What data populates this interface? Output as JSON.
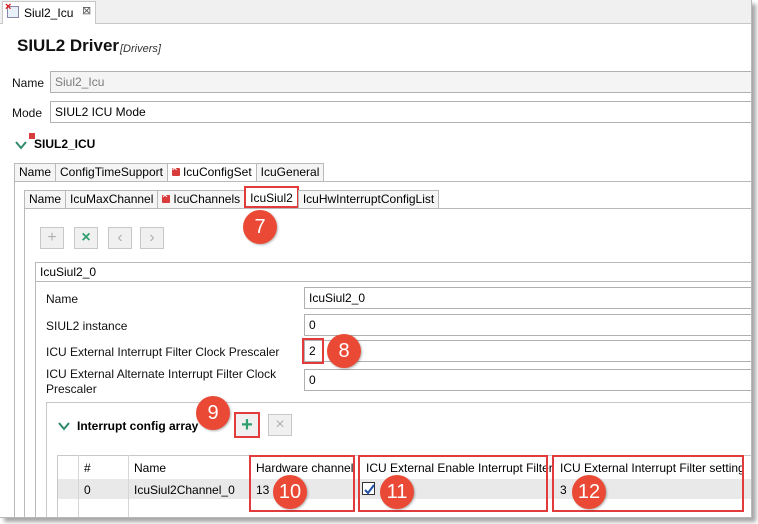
{
  "editor_tab": {
    "label": "Siul2_Icu",
    "close": "⊠"
  },
  "header": {
    "title": "SIUL2 Driver",
    "subtitle": "[Drivers]"
  },
  "form": {
    "name_label": "Name",
    "name_value": "Siul2_Icu",
    "mode_label": "Mode",
    "mode_value": "SIUL2 ICU Mode"
  },
  "section": {
    "title": "SIUL2_ICU"
  },
  "outer_tabs": [
    "Name",
    "ConfigTimeSupport",
    "IcuConfigSet",
    "IcuGeneral"
  ],
  "inner_tabs": [
    "Name",
    "IcuMaxChannel",
    "IcuChannels",
    "IcuSiul2",
    "IcuHwInterruptConfigList"
  ],
  "toolbar": {
    "add": "+",
    "remove": "×",
    "up": "‹",
    "down": "›"
  },
  "instance_tab": {
    "label": "IcuSiul2_0"
  },
  "fields": {
    "name": {
      "label": "Name",
      "value": "IcuSiul2_0"
    },
    "instance": {
      "label": "SIUL2 instance",
      "value": "0"
    },
    "prescaler": {
      "label": "ICU External Interrupt Filter Clock Prescaler",
      "value": "2"
    },
    "alt_prescaler": {
      "label": "ICU External Alternate Interrupt Filter Clock Prescaler",
      "value": "0"
    }
  },
  "interrupt": {
    "title": "Interrupt config array",
    "columns": [
      "#",
      "Name",
      "Hardware channel",
      "ICU External Enable Interrupt Filter",
      "ICU External Interrupt Filter setting"
    ],
    "rows": [
      {
        "index": "0",
        "name": "IcuSiul2Channel_0",
        "hw_channel": "13",
        "filter_enabled": true,
        "filter_setting": "3"
      }
    ]
  },
  "callouts": [
    "7",
    "8",
    "9",
    "10",
    "11",
    "12"
  ],
  "colors": {
    "callout": "#ea4a35",
    "highlight": "#e23b3b",
    "accent_green": "#2f9f6f"
  }
}
